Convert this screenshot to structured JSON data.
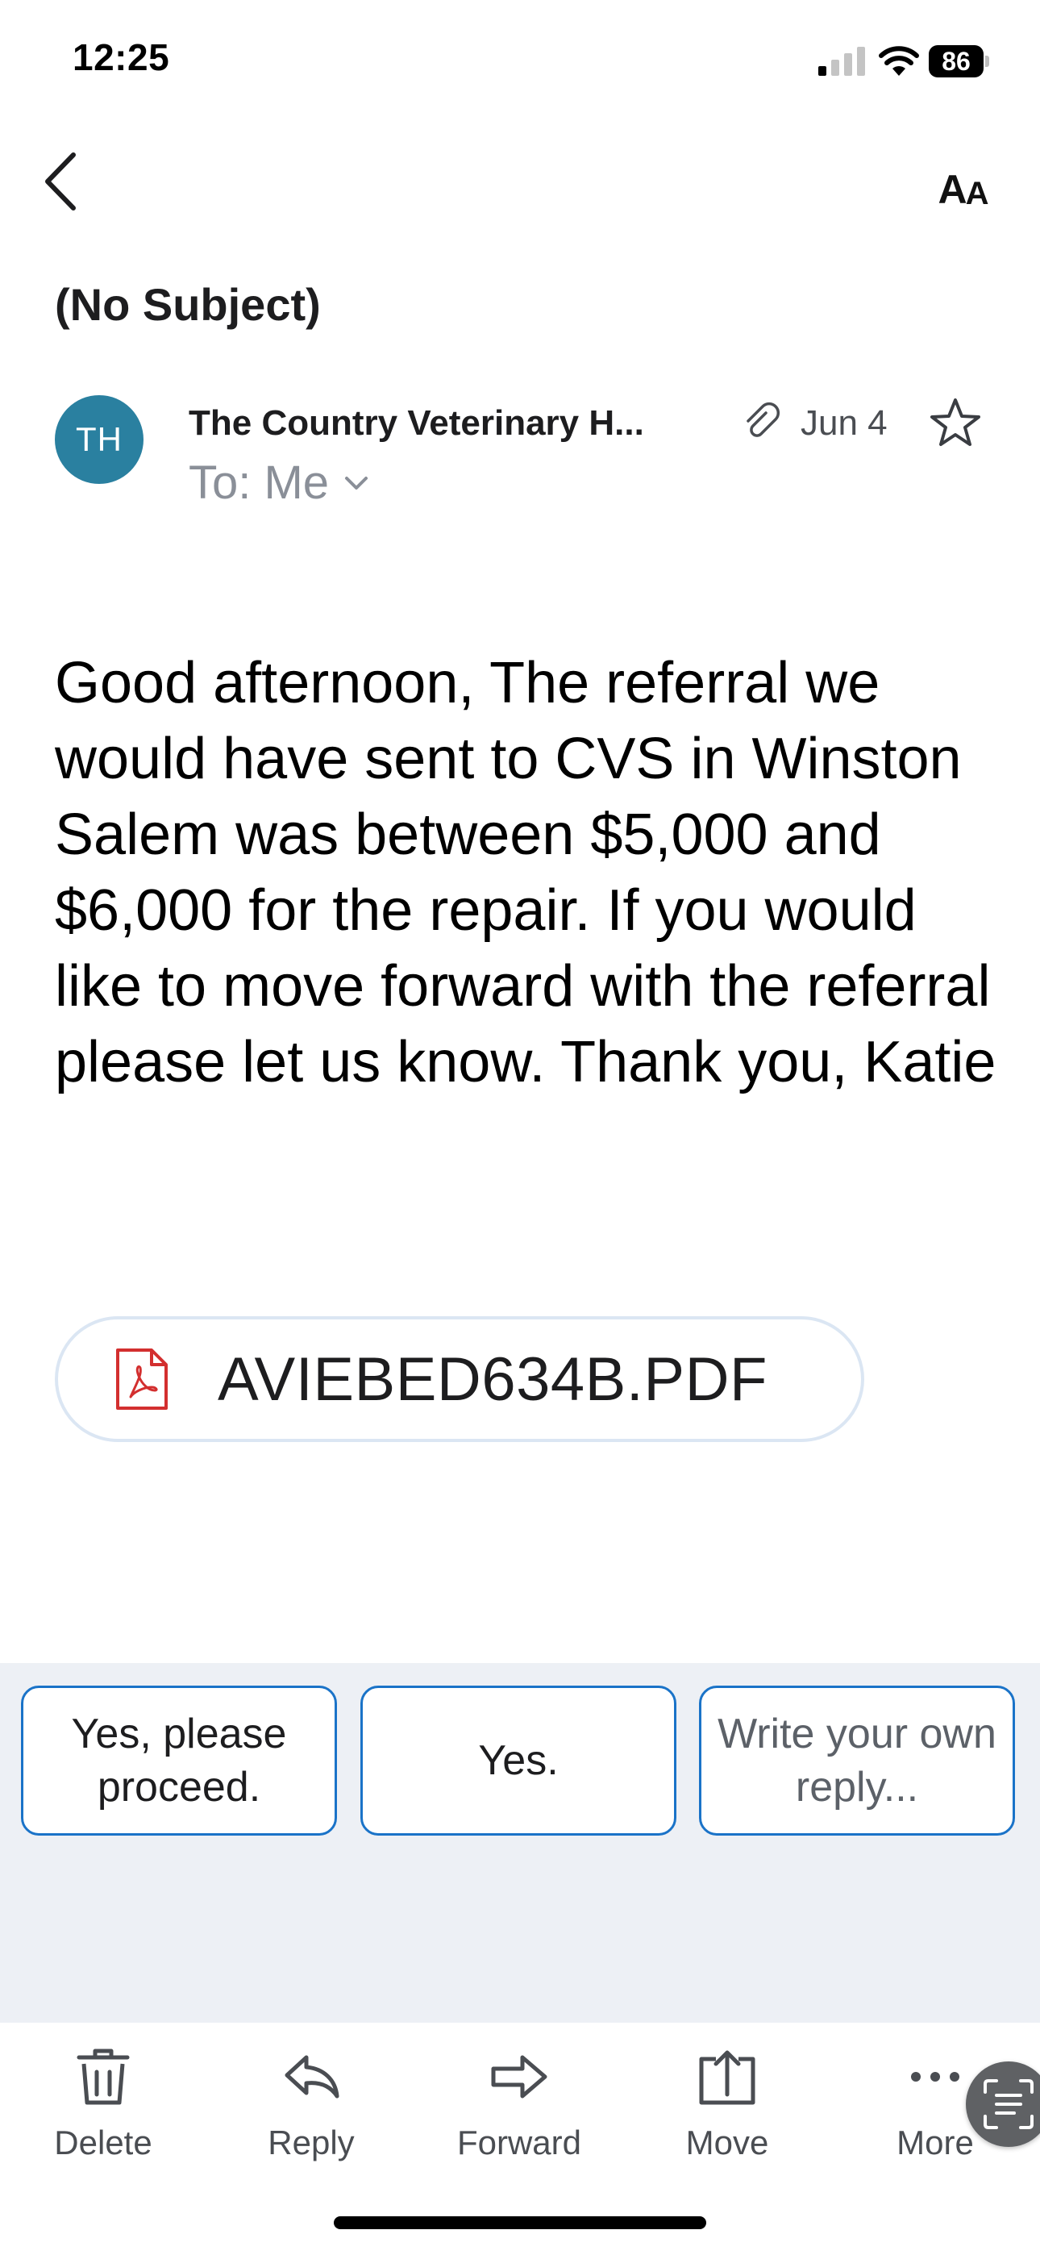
{
  "status_bar": {
    "time": "12:25",
    "battery_level": "86"
  },
  "nav": {
    "text_size_label_big": "A",
    "text_size_label_small": "A"
  },
  "email": {
    "subject": "(No Subject)",
    "sender": {
      "initials": "TH",
      "name": "The Country Veterinary H...",
      "avatar_color": "#2a80a0"
    },
    "recipient": "To: Me",
    "date": "Jun 4",
    "has_attachment": true,
    "body": "Good afternoon, The referral we would have sent to CVS in Winston Salem was between $5,000 and $6,000 for the repair. If you would like to move forward with the referral please let us know. Thank you, Katie",
    "attachment": {
      "filename": "AVIEBED634B.PDF",
      "type": "pdf-icon"
    }
  },
  "quick_replies": [
    {
      "label": "Yes, please proceed."
    },
    {
      "label": "Yes."
    },
    {
      "label": "Write your own reply..."
    }
  ],
  "toolbar": {
    "items": [
      {
        "label": "Delete",
        "icon": "trash-icon"
      },
      {
        "label": "Reply",
        "icon": "reply-icon"
      },
      {
        "label": "Forward",
        "icon": "forward-icon"
      },
      {
        "label": "Move",
        "icon": "move-icon"
      },
      {
        "label": "More",
        "icon": "more-icon"
      }
    ]
  },
  "colors": {
    "accent": "#1a73c8",
    "quick_reply_panel": "#edf0f5",
    "pdf_red": "#d32f2f"
  }
}
